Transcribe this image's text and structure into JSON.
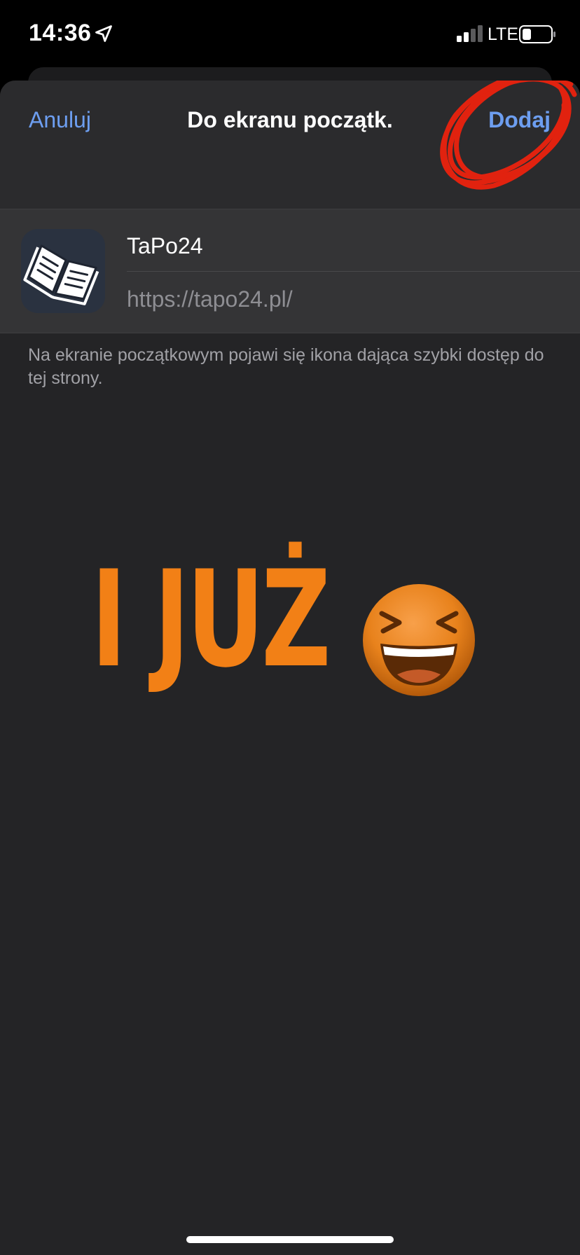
{
  "status_bar": {
    "time": "14:36",
    "network": "LTE",
    "icons": [
      "location-arrow-icon",
      "signal-icon",
      "battery-icon"
    ]
  },
  "nav": {
    "cancel_label": "Anuluj",
    "title": "Do ekranu początk.",
    "add_label": "Dodaj"
  },
  "form": {
    "icon": "open-book-icon",
    "name_value": "TaPo24",
    "url": "https://tapo24.pl/"
  },
  "footer_note": "Na ekranie początkowym pojawi się ikona dająca szybki dostęp do tej strony.",
  "overlay": {
    "caption": "I JUŻ",
    "emoji": "laughing-face-emoji"
  },
  "colors": {
    "accent_link": "#6d9ef0",
    "overlay_orange": "#f28016",
    "annotation_red": "#e1220f",
    "sheet_background": "#242426"
  }
}
